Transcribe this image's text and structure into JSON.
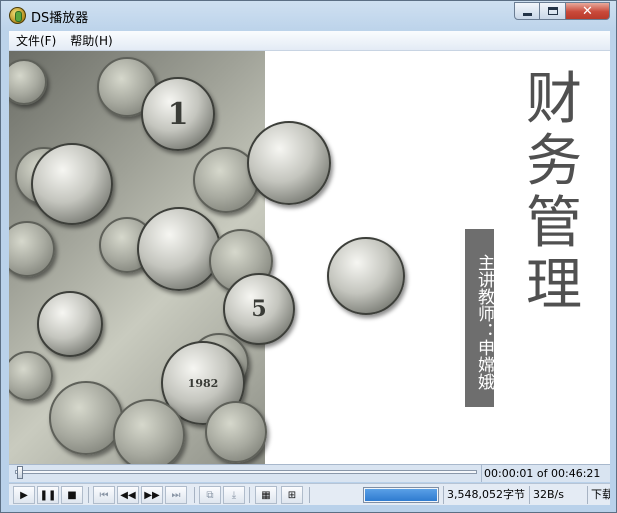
{
  "window": {
    "title": "DS播放器",
    "close_glyph": "✕"
  },
  "menu": [
    {
      "label": "文件(F)"
    },
    {
      "label": "帮助(H)"
    }
  ],
  "slide": {
    "title": "财务管理",
    "teacher": "主讲教师：申嫦娥",
    "coin_texts": [
      "1",
      "5",
      "1982"
    ]
  },
  "playback": {
    "time": "00:00:01 of 00:46:21",
    "progress": 0.0004,
    "bytes": "3,548,052字节",
    "rate": "32B/s",
    "status_clipped": "下载"
  },
  "toolbar_icons": [
    {
      "name": "play-icon",
      "glyph": "▶",
      "enabled": true
    },
    {
      "name": "pause-icon",
      "glyph": "❚❚",
      "enabled": true
    },
    {
      "name": "stop-icon",
      "glyph": "■",
      "enabled": true
    },
    {
      "name": "skip-start-icon",
      "glyph": "⏮",
      "enabled": false
    },
    {
      "name": "rewind-icon",
      "glyph": "◀◀",
      "enabled": true
    },
    {
      "name": "fast-forward-icon",
      "glyph": "▶▶",
      "enabled": true
    },
    {
      "name": "skip-end-icon",
      "glyph": "⏭",
      "enabled": false
    },
    {
      "name": "snapshot-icon",
      "glyph": "⧉",
      "enabled": false
    },
    {
      "name": "save-frame-icon",
      "glyph": "⤓",
      "enabled": false
    },
    {
      "name": "color-settings-icon",
      "glyph": "▦",
      "enabled": true
    },
    {
      "name": "fullscreen-icon",
      "glyph": "⊞",
      "enabled": true
    }
  ],
  "colors": {
    "progress_fill": "#2f7bd0",
    "teacher_bar": "#6e6e6e",
    "title_text": "#505050"
  }
}
